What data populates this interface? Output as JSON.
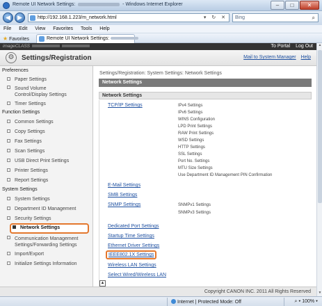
{
  "window": {
    "title_prefix": "Remote UI Network Settings:",
    "title_suffix": "- Windows Internet Explorer",
    "minimize_glyph": "–",
    "maximize_glyph": "□",
    "close_glyph": "✕"
  },
  "address": {
    "back_glyph": "◀",
    "forward_glyph": "▶",
    "url": "http://192.168.1.223/m_network.html",
    "actions": "▾ ↻ ✕",
    "search_placeholder": "Bing",
    "search_glyph": "⌕"
  },
  "menu": [
    "File",
    "Edit",
    "View",
    "Favorites",
    "Tools",
    "Help"
  ],
  "favorites": {
    "label": "Favorites",
    "tab_label": "Remote UI Network Settings:"
  },
  "device": {
    "name": "imageCLASS",
    "to_portal": "To Portal",
    "log_out": "Log Out"
  },
  "header": {
    "title": "Settings/Registration",
    "mail": "Mail to System Manager",
    "help": "Help"
  },
  "sidebar": {
    "preferences": "Preferences",
    "preferences_items": [
      "Paper Settings",
      "Sound Volume Control/Display Settings",
      "Timer Settings"
    ],
    "function": "Function Settings",
    "function_items": [
      "Common Settings",
      "Copy Settings",
      "Fax Settings",
      "Scan Settings",
      "USB Direct Print Settings",
      "Printer Settings",
      "Report Settings"
    ],
    "system": "System Settings",
    "system_items": [
      "System Settings",
      "Department ID Management",
      "Security Settings",
      "Network Settings",
      "Communication Management Settings/Forwarding Settings",
      "Import/Export",
      "Initialize Settings Information"
    ]
  },
  "content": {
    "breadcrumb": "Settings/Registration: System Settings: Network Settings",
    "bar_title": "Network Settings",
    "section_title": "Network Settings",
    "tcpip": "TCP/IP Settings",
    "tcpip_sub": [
      "IPv4 Settings",
      "IPv6 Settings",
      "WINS Configuration",
      "LPD Print Settings",
      "RAW Print Settings",
      "WSD Settings",
      "HTTP Settings",
      "SSL Settings",
      "Port No. Settings",
      "MTU Size Settings",
      "Use Department ID Management PIN Confirmation"
    ],
    "email": "E-Mail Settings",
    "smb": "SMB Settings",
    "snmp": "SNMP Settings",
    "snmp_sub": [
      "SNMPv1 Settings",
      "SNMPv3 Settings"
    ],
    "links_bottom": [
      "Dedicated Port Settings",
      "Startup Time Settings",
      "Ethernet Driver Settings",
      "IEEE802.1X Settings",
      "Wireless LAN Settings",
      "Select Wired/Wireless LAN"
    ],
    "top_glyph": "▲",
    "copyright": "Copyright CANON INC. 2011 All Rights Reserved"
  },
  "status": {
    "zone": "Internet | Protected Mode: Off",
    "zoom": "100%"
  }
}
